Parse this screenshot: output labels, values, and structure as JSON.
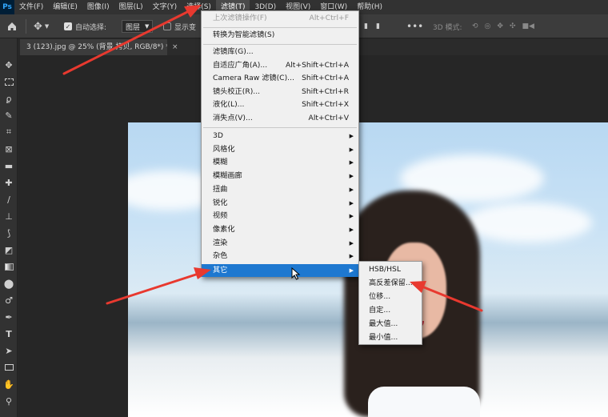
{
  "app": {
    "logo": "Ps"
  },
  "menubar": {
    "items": [
      "文件(F)",
      "编辑(E)",
      "图像(I)",
      "图层(L)",
      "文字(Y)",
      "选择(S)",
      "滤镜(T)",
      "3D(D)",
      "视图(V)",
      "窗口(W)",
      "帮助(H)"
    ],
    "active_index": 6
  },
  "options_bar": {
    "auto_select_label": "自动选择:",
    "auto_select_checked": true,
    "layer_select_value": "图层",
    "show_transform_label": "显示变",
    "mode_3d_label": "3D 模式:"
  },
  "document": {
    "tab_title": "3 (123).jpg @ 25% (背景 拷贝, RGB/8*) *",
    "tab_close": "×"
  },
  "filter_menu": {
    "items": [
      {
        "label": "上次滤镜操作(F)",
        "shortcut": "Alt+Ctrl+F",
        "disabled": true
      },
      {
        "separator": true
      },
      {
        "label": "转换为智能滤镜(S)"
      },
      {
        "separator": true
      },
      {
        "label": "滤镜库(G)..."
      },
      {
        "label": "自适应广角(A)...",
        "shortcut": "Alt+Shift+Ctrl+A"
      },
      {
        "label": "Camera Raw 滤镜(C)...",
        "shortcut": "Shift+Ctrl+A"
      },
      {
        "label": "镜头校正(R)...",
        "shortcut": "Shift+Ctrl+R"
      },
      {
        "label": "液化(L)...",
        "shortcut": "Shift+Ctrl+X"
      },
      {
        "label": "消失点(V)...",
        "shortcut": "Alt+Ctrl+V"
      },
      {
        "separator": true
      },
      {
        "label": "3D",
        "submenu": true
      },
      {
        "label": "风格化",
        "submenu": true
      },
      {
        "label": "模糊",
        "submenu": true
      },
      {
        "label": "模糊画廊",
        "submenu": true
      },
      {
        "label": "扭曲",
        "submenu": true
      },
      {
        "label": "锐化",
        "submenu": true
      },
      {
        "label": "视频",
        "submenu": true
      },
      {
        "label": "像素化",
        "submenu": true
      },
      {
        "label": "渲染",
        "submenu": true
      },
      {
        "label": "杂色",
        "submenu": true
      },
      {
        "label": "其它",
        "submenu": true,
        "highlighted": true
      }
    ]
  },
  "other_submenu": {
    "items": [
      "HSB/HSL",
      "高反差保留...",
      "位移...",
      "自定...",
      "最大值...",
      "最小值..."
    ]
  },
  "colors": {
    "menu_highlight": "#1e78d0",
    "annotation_arrow": "#e8392f",
    "menubar_bg": "#323232"
  },
  "icons": {
    "home": "home-icon",
    "move": "move-icon",
    "more": "more-icon"
  }
}
